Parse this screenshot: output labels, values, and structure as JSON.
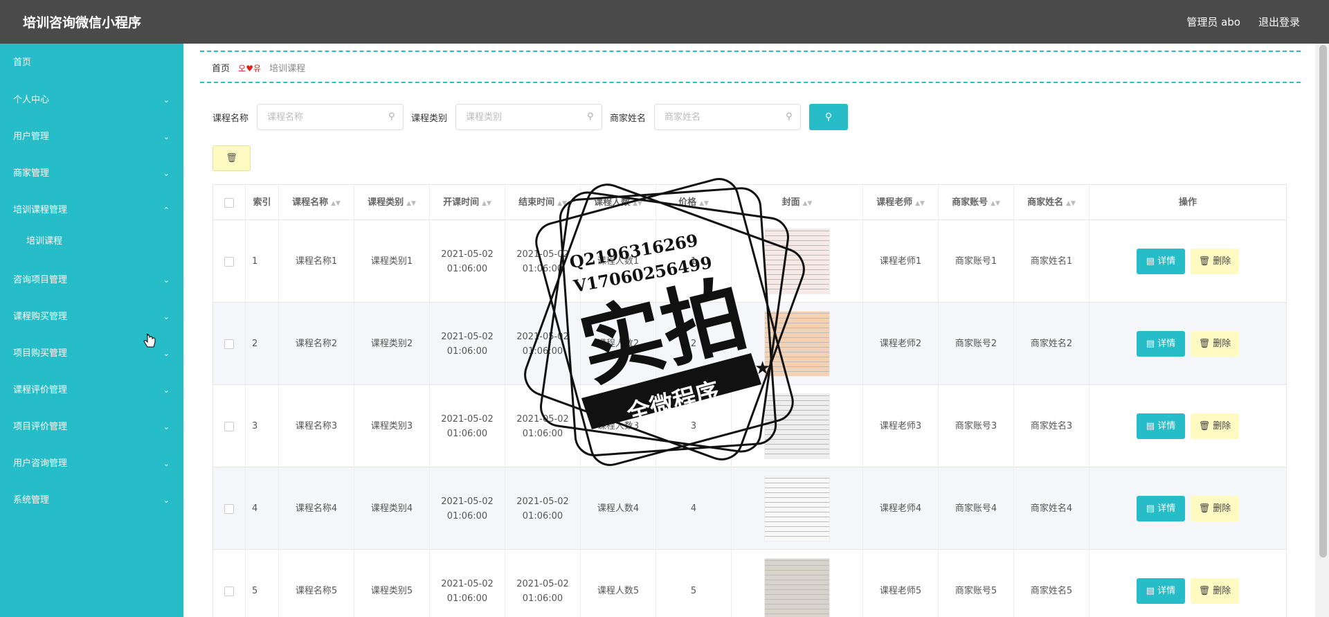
{
  "header": {
    "app_title": "培训咨询微信小程序",
    "user_label": "管理员 abo",
    "logout_label": "退出登录"
  },
  "sidebar": {
    "items": [
      {
        "label": "首页",
        "chevron": ""
      },
      {
        "label": "个人中心",
        "chevron": "down"
      },
      {
        "label": "用户管理",
        "chevron": "down"
      },
      {
        "label": "商家管理",
        "chevron": "down"
      },
      {
        "label": "培训课程管理",
        "chevron": "up"
      },
      {
        "label": "咨询项目管理",
        "chevron": "down"
      },
      {
        "label": "课程购买管理",
        "chevron": "down"
      },
      {
        "label": "项目购买管理",
        "chevron": "down"
      },
      {
        "label": "课程评价管理",
        "chevron": "down"
      },
      {
        "label": "项目评价管理",
        "chevron": "down"
      },
      {
        "label": "用户咨询管理",
        "chevron": "down"
      },
      {
        "label": "系统管理",
        "chevron": "down"
      }
    ],
    "submenu": {
      "label": "培训课程"
    }
  },
  "breadcrumb": {
    "home": "首页",
    "separator": "오♥유",
    "current": "培训课程"
  },
  "search": {
    "course_name_label": "课程名称",
    "course_name_placeholder": "课程名称",
    "course_type_label": "课程类别",
    "course_type_placeholder": "课程类别",
    "merchant_name_label": "商家姓名",
    "merchant_name_placeholder": "商家姓名",
    "search_icon": "search-icon",
    "delete_icon": "trash-icon"
  },
  "table": {
    "columns": [
      "索引",
      "课程名称",
      "课程类别",
      "开课时间",
      "结束时间",
      "课程人数",
      "价格",
      "封面",
      "课程老师",
      "商家账号",
      "商家姓名",
      "操作"
    ],
    "rows": [
      {
        "index": "1",
        "name": "课程名称1",
        "type": "课程类别1",
        "start": "2021-05-02 01:06:00",
        "end": "2021-05-02 01:06:00",
        "count": "课程人数1",
        "price": "1",
        "teacher": "课程老师1",
        "account": "商家账号1",
        "merchant": "商家姓名1"
      },
      {
        "index": "2",
        "name": "课程名称2",
        "type": "课程类别2",
        "start": "2021-05-02 01:06:00",
        "end": "2021-05-02 01:06:00",
        "count": "课程人数2",
        "price": "2",
        "teacher": "课程老师2",
        "account": "商家账号2",
        "merchant": "商家姓名2"
      },
      {
        "index": "3",
        "name": "课程名称3",
        "type": "课程类别3",
        "start": "2021-05-02 01:06:00",
        "end": "2021-05-02 01:06:00",
        "count": "课程人数3",
        "price": "3",
        "teacher": "课程老师3",
        "account": "商家账号3",
        "merchant": "商家姓名3"
      },
      {
        "index": "4",
        "name": "课程名称4",
        "type": "课程类别4",
        "start": "2021-05-02 01:06:00",
        "end": "2021-05-02 01:06:00",
        "count": "课程人数4",
        "price": "4",
        "teacher": "课程老师4",
        "account": "商家账号4",
        "merchant": "商家姓名4"
      },
      {
        "index": "5",
        "name": "课程名称5",
        "type": "课程类别5",
        "start": "2021-05-02 01:06:00",
        "end": "2021-05-02 01:06:00",
        "count": "课程人数5",
        "price": "5",
        "teacher": "课程老师5",
        "account": "商家账号5",
        "merchant": "商家姓名5"
      }
    ],
    "detail_label": "详情",
    "delete_label": "删除"
  },
  "watermark": {
    "line1": "Q2196316269",
    "line2": "V17060256499",
    "big": "实拍",
    "ribbon": "全微程序"
  },
  "colors": {
    "accent": "#26bcc8",
    "header_bg": "#4a4a4a",
    "delete_btn": "#fffac2"
  }
}
